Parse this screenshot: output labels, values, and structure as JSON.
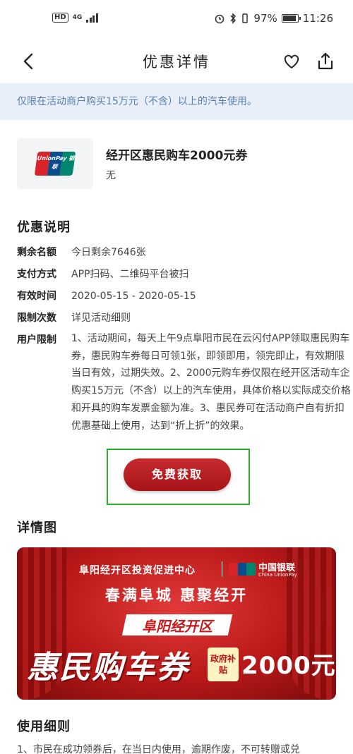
{
  "status_bar": {
    "hd": "HD",
    "network": "4G",
    "battery": "97%",
    "battery_level": 0.97,
    "time": "11:26"
  },
  "nav": {
    "title": "优惠详情"
  },
  "notice": "仅限在活动商户购买15万元（不含）以上的汽车使用。",
  "coupon": {
    "logo_text": "UnionPay 银联",
    "title": "经开区惠民购车2000元券",
    "subtitle": "无"
  },
  "description": {
    "heading": "优惠说明",
    "rows": [
      {
        "label": "剩余名额",
        "value": "今日剩余7646张"
      },
      {
        "label": "支付方式",
        "value": "APP扫码、二维码平台被扫"
      },
      {
        "label": "有效时间",
        "value": "2020-05-15 - 2020-05-15"
      },
      {
        "label": "限制次数",
        "value": "详见活动细则"
      }
    ],
    "limit_label": "用户限制",
    "limit_text": "1、活动期间，每天上午9点阜阳市民在云闪付APP领取惠民购车券，惠民购车券每日可领1张，即领即用，领完即止，有效期限当日有效，过期失效。2、2000元购车券仅限在经开区活动车企购买15万元（不含）以上的汽车使用，具体价格以实际成交价格和开具的购车发票金额为准。3、惠民券可在活动商户自有折扣优惠基础上使用，达到“折上折”的效果。"
  },
  "claim_button": "免费获取",
  "details": {
    "heading": "详情图",
    "banner": {
      "org": "阜阳经开区投资促进中心",
      "unionpay_cn": "中国银联",
      "unionpay_en": "China UnionPay",
      "slogan": "春满阜城  惠聚经开",
      "zone": "阜阳经开区",
      "main": "惠民购车券",
      "badge": "政府补贴",
      "amount": "2000元"
    }
  },
  "rules": {
    "heading": "使用细则",
    "text": "1、市民在成功领券后，在当日内使用，逾期作废，不可转赠或兑"
  },
  "colors": {
    "accent_red": "#b81818",
    "notice_bg": "#e8eff8",
    "notice_text": "#5a7fb0",
    "highlight_green": "#2faa2f"
  }
}
